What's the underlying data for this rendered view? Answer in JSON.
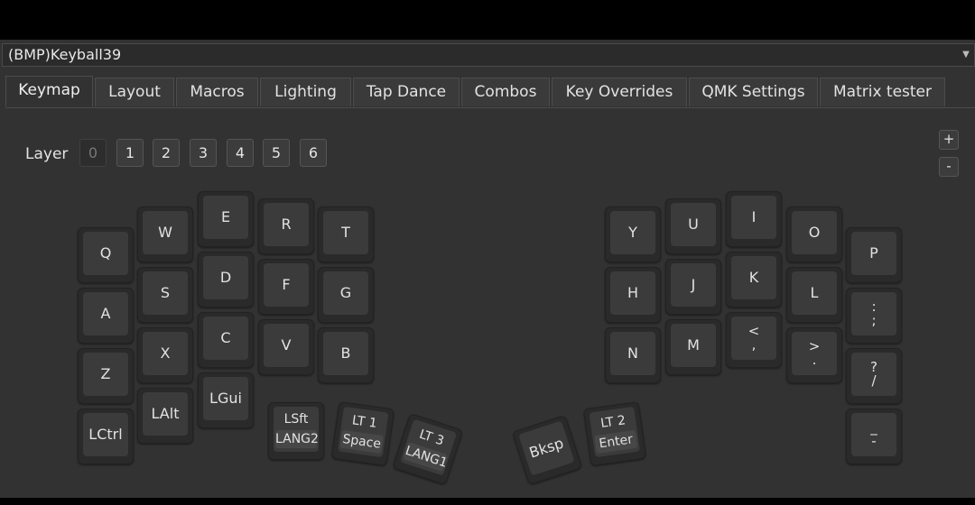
{
  "device": {
    "name": "(BMP)Keyball39",
    "dropdown_icon": "triangle-down-icon"
  },
  "tabs": [
    "Keymap",
    "Layout",
    "Macros",
    "Lighting",
    "Tap Dance",
    "Combos",
    "Key Overrides",
    "QMK Settings",
    "Matrix tester"
  ],
  "active_tab": "Keymap",
  "layer": {
    "label": "Layer",
    "options": [
      "0",
      "1",
      "2",
      "3",
      "4",
      "5",
      "6"
    ],
    "selected": "0"
  },
  "zoom": {
    "in": "+",
    "out": "-"
  },
  "keys": {
    "q": "Q",
    "w": "W",
    "e": "E",
    "r": "R",
    "t": "T",
    "a": "A",
    "s": "S",
    "d": "D",
    "f": "F",
    "g": "G",
    "z": "Z",
    "x": "X",
    "c": "C",
    "v": "V",
    "b": "B",
    "lctrl": "LCtrl",
    "lalt": "LAlt",
    "lgui": "LGui",
    "lsft_top": "LSft",
    "lsft_bottom": "LANG2",
    "lt1_top": "LT 1",
    "lt1_bottom": "Space",
    "lt3_top": "LT 3",
    "lt3_bottom": "LANG1",
    "bksp": "Bksp",
    "lt2_top": "LT 2",
    "lt2_bottom": "Enter",
    "y": "Y",
    "u": "U",
    "i": "I",
    "o": "O",
    "p": "P",
    "h": "H",
    "j": "J",
    "k": "K",
    "l": "L",
    "semicolon_top": ":",
    "semicolon_bottom": ";",
    "n": "N",
    "m": "M",
    "comma_top": "<",
    "comma_bottom": ",",
    "dot_top": ">",
    "dot_bottom": ".",
    "slash_top": "?",
    "slash_bottom": "/",
    "minus_top": "_",
    "minus_bottom": "-"
  }
}
